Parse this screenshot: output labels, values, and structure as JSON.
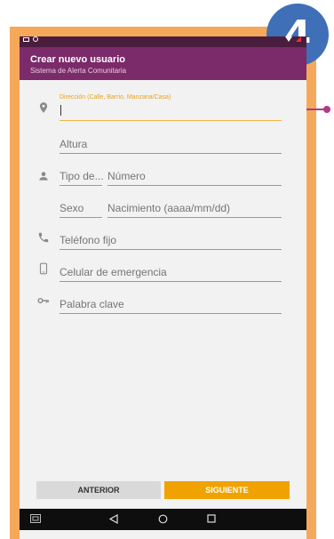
{
  "badge": {
    "number": "4",
    "color": "#3f6fb6"
  },
  "appbar": {
    "title": "Crear nuevo usuario",
    "subtitle": "Sistema de Alerta Comunitaria",
    "color": "#7b2a6a"
  },
  "form": {
    "direccion_label": "Dirección (Calle, Barrio, Manzana/Casa)",
    "direccion_value": "",
    "altura_placeholder": "Altura",
    "tipo_doc_placeholder": "Tipo de...",
    "numero_placeholder": "Número",
    "sexo_placeholder": "Sexo",
    "nacimiento_placeholder": "Nacimiento (aaaa/mm/dd)",
    "telefono_placeholder": "Teléfono fijo",
    "celular_placeholder": "Celular de emergencia",
    "clave_placeholder": "Palabra clave"
  },
  "icons": {
    "location": "location-pin-icon",
    "person": "person-icon",
    "phone": "phone-icon",
    "mobile": "mobile-icon",
    "key": "key-icon"
  },
  "buttons": {
    "prev_label": "ANTERIOR",
    "next_label": "SIGUIENTE",
    "next_color": "#f0a300"
  },
  "colors": {
    "frame": "#f6a85a",
    "callout": "#b13a86"
  }
}
